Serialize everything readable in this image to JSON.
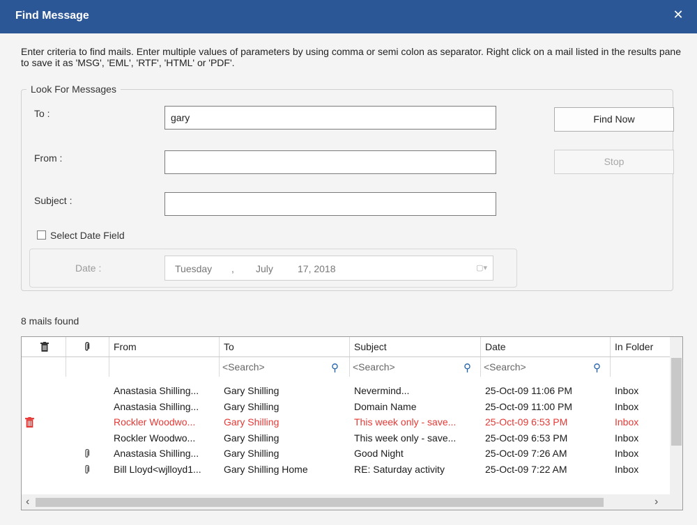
{
  "window": {
    "title": "Find Message",
    "close_glyph": "✕"
  },
  "instructions": "Enter criteria to find mails. Enter multiple values of parameters by using comma or semi colon as separator. Right click on a mail listed in the results pane to save it as 'MSG', 'EML', 'RTF', 'HTML' or 'PDF'.",
  "look_for": {
    "legend": "Look For Messages",
    "to_label": "To :",
    "to_value": "gary",
    "from_label": "From :",
    "from_value": "",
    "subject_label": "Subject :",
    "subject_value": "",
    "select_date_label": "Select Date Field",
    "select_date_checked": false,
    "date_label": "Date :",
    "date_weekday": "Tuesday",
    "date_sep": ",",
    "date_month": "July",
    "date_day_year": "17, 2018"
  },
  "buttons": {
    "find_now": "Find Now",
    "stop": "Stop"
  },
  "results": {
    "count_text": "8 mails found",
    "columns": [
      "",
      "",
      "From",
      "To",
      "Subject",
      "Date",
      "In Folder"
    ],
    "search_placeholder": "<Search>",
    "rows": [
      {
        "deleted": false,
        "attachment": false,
        "from": "Anastasia Shilling...",
        "to": "Gary Shilling",
        "subject": "Nevermind...",
        "date": "25-Oct-09 11:06 PM",
        "folder": "Inbox",
        "highlight": false
      },
      {
        "deleted": false,
        "attachment": false,
        "from": "Anastasia Shilling...",
        "to": "Gary Shilling",
        "subject": "Domain Name",
        "date": "25-Oct-09 11:00 PM",
        "folder": "Inbox",
        "highlight": false
      },
      {
        "deleted": true,
        "attachment": false,
        "from": "Rockler Woodwo...",
        "to": "Gary Shilling",
        "subject": "This week only - save...",
        "date": "25-Oct-09 6:53 PM",
        "folder": "Inbox",
        "highlight": true
      },
      {
        "deleted": false,
        "attachment": false,
        "from": "Rockler Woodwo...",
        "to": "Gary Shilling",
        "subject": "This week only - save...",
        "date": "25-Oct-09 6:53 PM",
        "folder": "Inbox",
        "highlight": false
      },
      {
        "deleted": false,
        "attachment": true,
        "from": "Anastasia Shilling...",
        "to": "Gary Shilling",
        "subject": "Good Night",
        "date": "25-Oct-09 7:26 AM",
        "folder": "Inbox",
        "highlight": false
      },
      {
        "deleted": false,
        "attachment": true,
        "from": "Bill Lloyd<wjlloyd1...",
        "to": "Gary Shilling Home",
        "subject": "RE: Saturday activity",
        "date": "25-Oct-09 7:22 AM",
        "folder": "Inbox",
        "highlight": false
      }
    ]
  },
  "icons": {
    "close": "close-icon",
    "trash": "trash-icon",
    "paperclip": "paperclip-icon",
    "search": "search-icon"
  },
  "colors": {
    "titlebar": "#2b5797",
    "highlight_text": "#e53935",
    "link_icon": "#1f5fa8"
  }
}
